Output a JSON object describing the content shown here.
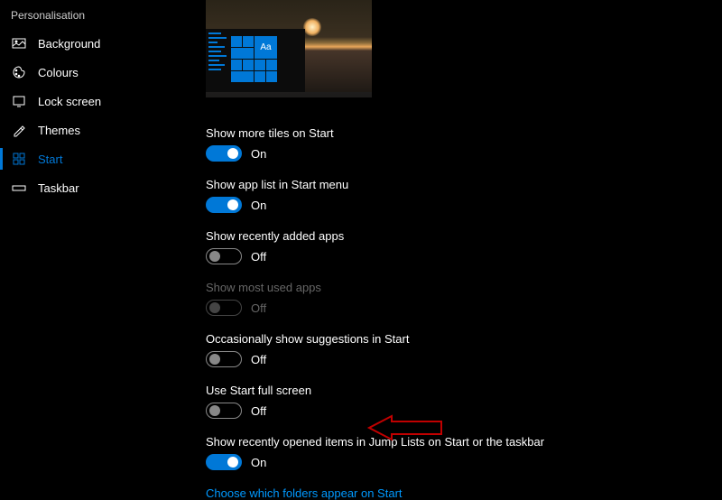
{
  "sidebar": {
    "title": "Personalisation",
    "items": [
      {
        "label": "Background"
      },
      {
        "label": "Colours"
      },
      {
        "label": "Lock screen"
      },
      {
        "label": "Themes"
      },
      {
        "label": "Start"
      },
      {
        "label": "Taskbar"
      }
    ]
  },
  "preview": {
    "tile_letter": "Aa"
  },
  "toggle_labels": {
    "on": "On",
    "off": "Off"
  },
  "settings": [
    {
      "label": "Show more tiles on Start",
      "on": true,
      "disabled": false
    },
    {
      "label": "Show app list in Start menu",
      "on": true,
      "disabled": false
    },
    {
      "label": "Show recently added apps",
      "on": false,
      "disabled": false
    },
    {
      "label": "Show most used apps",
      "on": false,
      "disabled": true
    },
    {
      "label": "Occasionally show suggestions in Start",
      "on": false,
      "disabled": false
    },
    {
      "label": "Use Start full screen",
      "on": false,
      "disabled": false
    },
    {
      "label": "Show recently opened items in Jump Lists on Start or the taskbar",
      "on": true,
      "disabled": false
    }
  ],
  "link": "Choose which folders appear on Start"
}
